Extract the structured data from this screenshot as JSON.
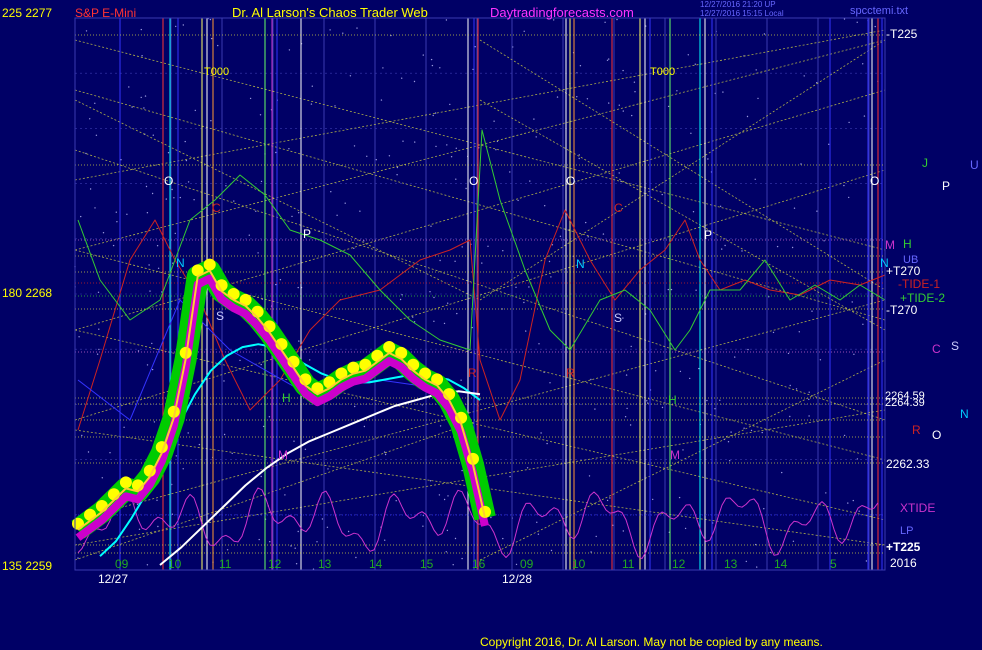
{
  "header": {
    "left_scale": "225  2277",
    "symbol": "S&P E-Mini",
    "title": "Dr. Al Larson's Chaos Trader Web",
    "site": "Daytradingforecasts.com",
    "stamp1": "12/27/2016 21:20 UP",
    "stamp2": "12/27/2016 15:15 Local",
    "file": "spcctemi.txt"
  },
  "footer": {
    "copyright": "Copyright 2016, Dr. Al Larson. May not be copied by any means."
  },
  "left_scale": {
    "top": "225  2277",
    "mid": "180  2268",
    "bottom": "135  2259"
  },
  "colors": {
    "background": "#000066",
    "grid": "#3a3ab0",
    "price": "#ffff00",
    "price_band": "#00cc00",
    "price_low": "#cc00cc",
    "ma_fast": "#00ffff",
    "ma_slow": "#ffffff",
    "xtide": "#cc33cc",
    "tide1": "#cc2222",
    "tide2": "#33cc33",
    "red_vline": "#ff3333",
    "white_vline": "#ffffff",
    "cyan_vline": "#00ffff",
    "yellow_vline": "#ffff66",
    "green_vline": "#66ff66"
  },
  "chart_data": {
    "type": "line",
    "x_tick_labels": [
      "09",
      "10",
      "11",
      "12",
      "13",
      "14",
      "15",
      "16",
      "09",
      "10",
      "11",
      "12",
      "13",
      "14",
      "5",
      "2016"
    ],
    "x_tick_hours": [
      9,
      10,
      11,
      12,
      13,
      14,
      15,
      16,
      9,
      10,
      11,
      12,
      13,
      14,
      5,
      "2016"
    ],
    "date_labels": [
      "12/27",
      "12/28"
    ],
    "y_left_labels": [
      "225  2277",
      "180  2268",
      "135  2259"
    ],
    "y_price_range": [
      2259,
      2277
    ],
    "series": [
      {
        "name": "",
        "values": [
          2260.2,
          2260.5,
          2260.8,
          2261.2,
          2261.6,
          2261.5,
          2262.0,
          2262.8,
          2264.0,
          2266.0,
          2268.8,
          2269.0,
          2268.3,
          2268.0,
          2267.8,
          2267.4,
          2266.9,
          2266.3,
          2265.7,
          2265.1,
          2264.8,
          2265.0,
          2265.3,
          2265.5,
          2265.6,
          2265.9,
          2266.2,
          2266.0,
          2265.6,
          2265.3,
          2265.1,
          2264.6,
          2263.8,
          2262.4,
          2260.6
        ]
      },
      {
        "name": "",
        "values": [
          2259.3,
          2259.8,
          2260.6,
          2261.5,
          2262.6,
          2263.8,
          2264.8,
          2265.6,
          2266.1,
          2266.4,
          2266.5,
          2266.4,
          2266.1,
          2265.8,
          2265.5,
          2265.3,
          2265.2,
          2265.2,
          2265.3,
          2265.4,
          2265.5,
          2265.4,
          2265.3,
          2265.0,
          2264.6
        ]
      },
      {
        "name": "",
        "values": [
          2259.0,
          2259.6,
          2260.3,
          2261.0,
          2261.7,
          2262.3,
          2262.8,
          2263.2,
          2263.5,
          2263.8,
          2264.1,
          2264.4,
          2264.6,
          2264.8,
          2264.9,
          2264.8
        ]
      }
    ],
    "level_labels": [
      "-T225",
      "+T270",
      "-TIDE-1",
      "+TIDE-2",
      "-T270",
      "2264.59",
      "2264.39",
      "2262.33",
      "XTIDE",
      "+T225",
      "2016"
    ],
    "markers": [
      "T000",
      "T000",
      "O",
      "O",
      "O",
      "O",
      "C",
      "C",
      "P",
      "P",
      "N",
      "N",
      "N",
      "S",
      "S",
      "R",
      "R",
      "H",
      "H",
      "M",
      "M",
      "J",
      "U",
      "UB"
    ],
    "right_planet_labels": [
      "J",
      "U",
      "P",
      "M",
      "H",
      "UB",
      "C",
      "S",
      "N",
      "R",
      "O",
      "XTIDE",
      "LP"
    ]
  }
}
